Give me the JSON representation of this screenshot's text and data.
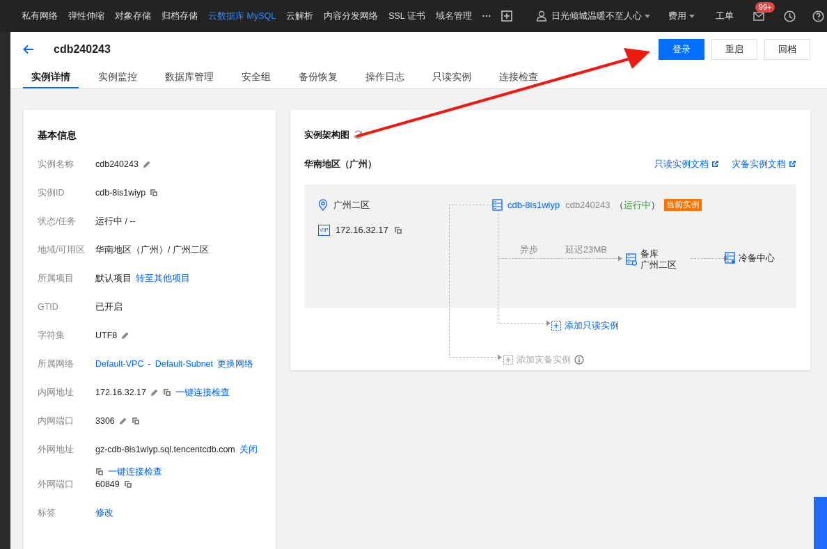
{
  "topnav": {
    "items": [
      {
        "label": "私有网络",
        "selected": false
      },
      {
        "label": "弹性伸缩",
        "selected": false
      },
      {
        "label": "对象存储",
        "selected": false
      },
      {
        "label": "归档存储",
        "selected": false
      },
      {
        "label": "云数据库 MySQL",
        "selected": true
      },
      {
        "label": "云解析",
        "selected": false
      },
      {
        "label": "内容分发网络",
        "selected": false
      },
      {
        "label": "SSL 证书",
        "selected": false
      },
      {
        "label": "域名管理",
        "selected": false
      }
    ],
    "more": "···",
    "user": "日光倾城温暖不至人心",
    "billing": "费用",
    "ticket": "工单",
    "badge": "99+"
  },
  "header": {
    "title": "cdb240243",
    "buttons": [
      {
        "label": "登录",
        "primary": true
      },
      {
        "label": "重启",
        "primary": false
      },
      {
        "label": "回档",
        "primary": false
      }
    ],
    "tabs": [
      {
        "label": "实例详情",
        "selected": true
      },
      {
        "label": "实例监控",
        "selected": false
      },
      {
        "label": "数据库管理",
        "selected": false
      },
      {
        "label": "安全组",
        "selected": false
      },
      {
        "label": "备份恢复",
        "selected": false
      },
      {
        "label": "操作日志",
        "selected": false
      },
      {
        "label": "只读实例",
        "selected": false
      },
      {
        "label": "连接检查",
        "selected": false
      }
    ]
  },
  "basic_info": {
    "title": "基本信息",
    "rows": [
      {
        "label": "实例名称",
        "parts": [
          {
            "kind": "text",
            "text": "cdb240243"
          },
          {
            "kind": "edit"
          }
        ]
      },
      {
        "label": "实例ID",
        "parts": [
          {
            "kind": "text",
            "text": "cdb-8is1wiyp"
          },
          {
            "kind": "copy"
          }
        ]
      },
      {
        "label": "状态/任务",
        "parts": [
          {
            "kind": "text",
            "text": "运行中 / --"
          }
        ]
      },
      {
        "label": "地域/可用区",
        "parts": [
          {
            "kind": "text",
            "text": "华南地区（广州）/ 广州二区"
          }
        ]
      },
      {
        "label": "所属项目",
        "parts": [
          {
            "kind": "text",
            "text": "默认项目"
          },
          {
            "kind": "link",
            "text": "转至其他项目"
          }
        ]
      },
      {
        "label": "GTID",
        "parts": [
          {
            "kind": "text",
            "text": "已开启"
          }
        ]
      },
      {
        "label": "字符集",
        "parts": [
          {
            "kind": "text",
            "text": "UTF8"
          },
          {
            "kind": "edit"
          }
        ]
      },
      {
        "label": "所属网络",
        "parts": [
          {
            "kind": "link",
            "text": "Default-VPC"
          },
          {
            "kind": "text",
            "text": "-"
          },
          {
            "kind": "link",
            "text": "Default-Subnet"
          },
          {
            "kind": "link",
            "text": "更换网络"
          }
        ]
      },
      {
        "label": "内网地址",
        "parts": [
          {
            "kind": "text",
            "text": "172.16.32.17"
          },
          {
            "kind": "edit"
          },
          {
            "kind": "copy"
          },
          {
            "kind": "link",
            "text": "一键连接检查"
          }
        ]
      },
      {
        "label": "内网端口",
        "parts": [
          {
            "kind": "text",
            "text": "3306"
          },
          {
            "kind": "edit"
          },
          {
            "kind": "copy"
          }
        ]
      },
      {
        "label": "外网地址",
        "parts": [
          {
            "kind": "text",
            "text": "gz-cdb-8is1wiyp.sql.tencentcdb.com"
          },
          {
            "kind": "link",
            "text": "关闭"
          },
          {
            "kind": "break"
          },
          {
            "kind": "copy"
          },
          {
            "kind": "link",
            "text": "一键连接检查"
          }
        ]
      },
      {
        "label": "外网端口",
        "parts": [
          {
            "kind": "text",
            "text": "60849"
          },
          {
            "kind": "copy"
          }
        ]
      },
      {
        "label": "标签",
        "parts": [
          {
            "kind": "link",
            "text": "修改"
          }
        ]
      }
    ]
  },
  "architecture": {
    "title": "实例架构图",
    "region": "华南地区（广州）",
    "doc_links": [
      "只读实例文档",
      "灾备实例文档"
    ],
    "zone": "广州二区",
    "vip": "VIP",
    "ip": "172.16.32.17",
    "instance": {
      "id": "cdb-8is1wiyp",
      "name": "cdb240243",
      "status_open": "（",
      "status": "运行中",
      "status_close": "）",
      "tag": "当前实例"
    },
    "sync": "异步",
    "delay": "延迟23MB",
    "replica": {
      "title": "备库",
      "zone": "广州二区"
    },
    "cold_backup": "冷备中心",
    "add_readonly": {
      "label": "添加只读实例",
      "disabled": false
    },
    "add_disaster": {
      "label": "添加灾备实例",
      "disabled": true
    }
  }
}
